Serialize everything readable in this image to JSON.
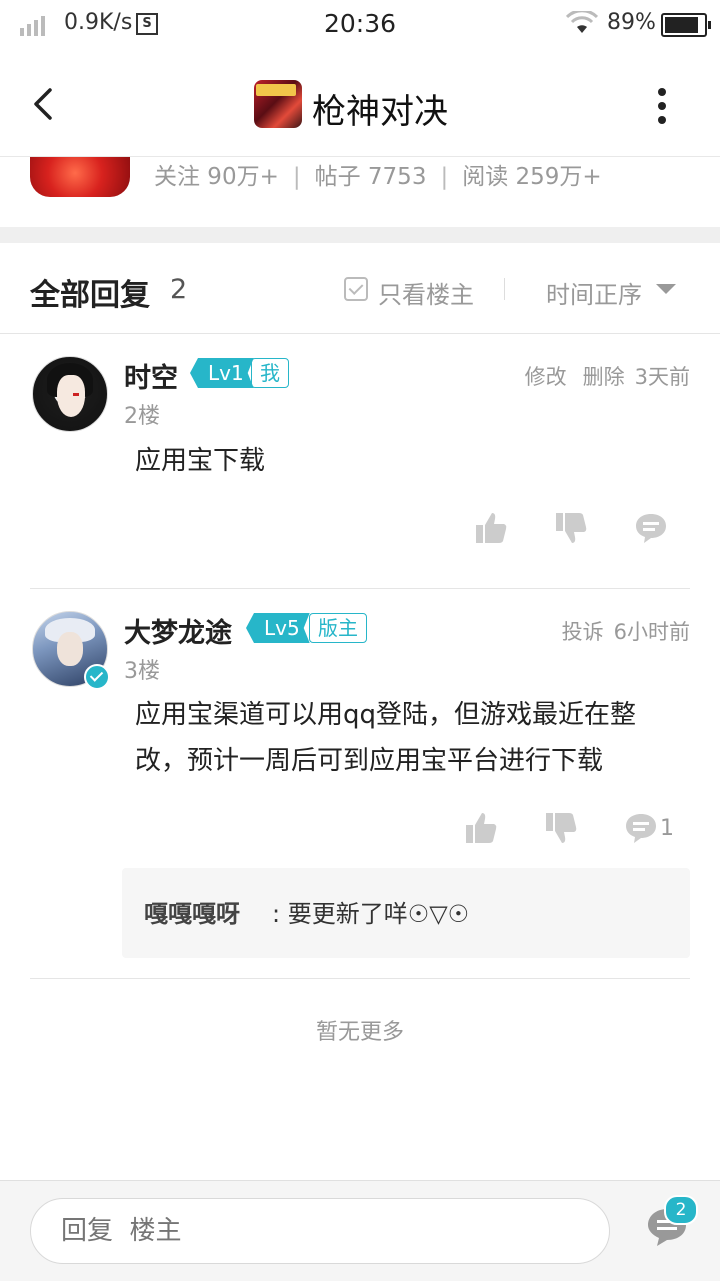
{
  "status_bar": {
    "speed": "0.9K/s",
    "s_icon": "S",
    "time": "20:36",
    "battery": "89%"
  },
  "header": {
    "title": "枪神对决"
  },
  "forum": {
    "follow": "关注 90万+",
    "posts": "帖子 7753",
    "reads": "阅读 259万+"
  },
  "replies_header": {
    "title": "全部回复",
    "count": "2",
    "only_owner": "只看楼主",
    "sort": "时间正序"
  },
  "replies": [
    {
      "name": "时空",
      "level": "Lv1",
      "tag": "我",
      "floor": "2楼",
      "actions": [
        "修改",
        "删除"
      ],
      "time": "3天前",
      "content": "应用宝下载"
    },
    {
      "name": "大梦龙途",
      "level": "Lv5",
      "tag": "版主",
      "floor": "3楼",
      "actions": [
        "投诉"
      ],
      "time": "6小时前",
      "content": "应用宝渠道可以用qq登陆，但游戏最近在整改，预计一周后可到应用宝平台进行下载",
      "comment_count": "1",
      "sub_reply": {
        "author": "嘎嘎嘎呀",
        "text": ": 要更新了咩☉▽☉"
      }
    }
  ],
  "no_more": "暂无更多",
  "bottom_bar": {
    "placeholder": "回复  楼主",
    "badge": "2"
  },
  "colors": {
    "accent": "#27b6c9",
    "muted": "#999999",
    "icon_gray": "#cccccc"
  }
}
